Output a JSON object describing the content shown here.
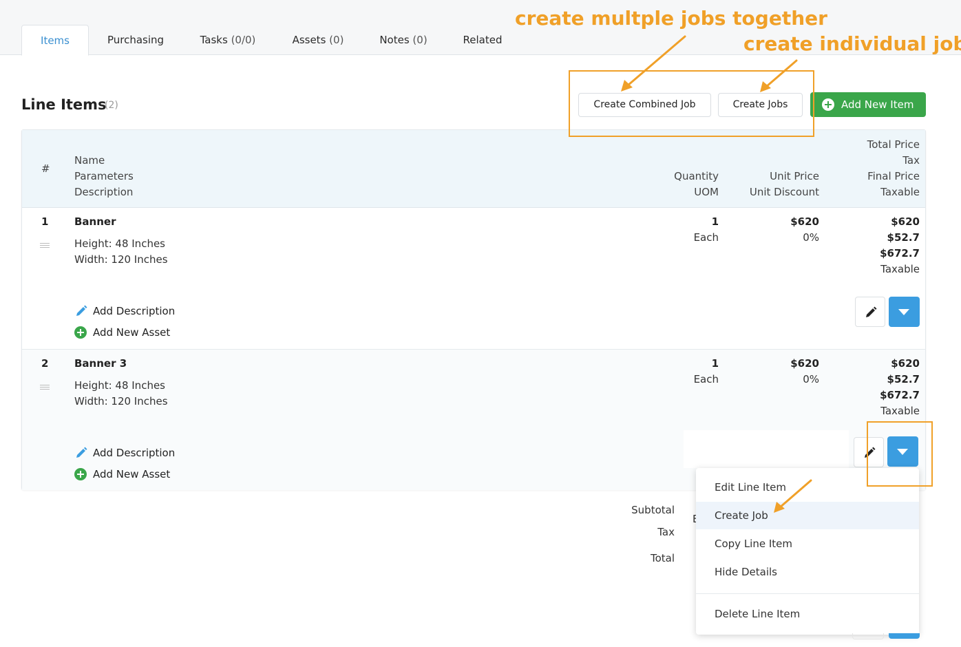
{
  "tabs": [
    {
      "label": "Items",
      "count": ""
    },
    {
      "label": "Purchasing",
      "count": ""
    },
    {
      "label": "Tasks",
      "count": "(0/0)"
    },
    {
      "label": "Assets",
      "count": "(0)"
    },
    {
      "label": "Notes",
      "count": "(0)"
    },
    {
      "label": "Related",
      "count": ""
    }
  ],
  "section": {
    "title": "Line Items",
    "count": "(2)"
  },
  "toolbar": {
    "combined_label": "Create Combined Job",
    "jobs_label": "Create Jobs",
    "add_label": "Add New Item"
  },
  "columns": {
    "num": "#",
    "name": "Name",
    "parameters": "Parameters",
    "description": "Description",
    "quantity": "Quantity",
    "uom": "UOM",
    "unit_price": "Unit Price",
    "unit_discount": "Unit Discount",
    "total_price": "Total Price",
    "tax": "Tax",
    "final_price": "Final Price",
    "taxable": "Taxable"
  },
  "rows": [
    {
      "num": "1",
      "name": "Banner",
      "param1": "Height: 48 Inches",
      "param2": "Width: 120 Inches",
      "qty": "1",
      "uom": "Each",
      "unit_price": "$620",
      "discount": "0%",
      "total": "$620",
      "tax": "$52.7",
      "final": "$672.7",
      "taxable": "Taxable"
    },
    {
      "num": "2",
      "name": "Banner 3",
      "param1": "Height: 48 Inches",
      "param2": "Width: 120 Inches",
      "qty": "1",
      "uom": "Each",
      "unit_price": "$620",
      "discount": "0%",
      "total": "$620",
      "tax": "$52.7",
      "final": "$672.7",
      "taxable": "Taxable"
    }
  ],
  "row_actions": {
    "add_description": "Add Description",
    "add_asset": "Add New Asset"
  },
  "totals": {
    "subtotal": "Subtotal",
    "tax": "Tax",
    "total": "Total",
    "clipped_glyph": "E"
  },
  "menu": {
    "items": [
      "Edit Line Item",
      "Create Job",
      "Copy Line Item",
      "Hide Details",
      "Delete Line Item"
    ],
    "highlighted": "Create Job"
  },
  "annotations": {
    "combined": "create multple jobs together",
    "individual": "create individual jobs"
  },
  "colors": {
    "accent": "#3b9de0",
    "green": "#3aa64a",
    "annotation": "#f0a028"
  }
}
